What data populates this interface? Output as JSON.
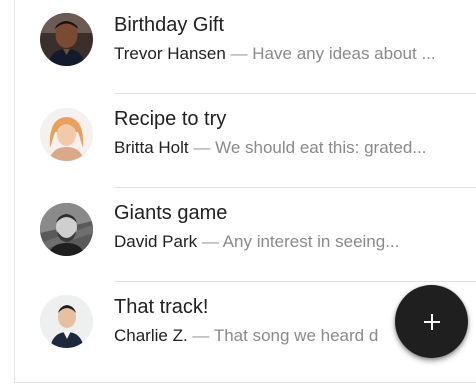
{
  "conversations": [
    {
      "title": "Birthday Gift",
      "sender": "Trevor Hansen",
      "separator": "—",
      "snippet": "Have any ideas about ...",
      "avatar_icon": "person-avatar"
    },
    {
      "title": "Recipe to try",
      "sender": "Britta Holt",
      "separator": "—",
      "snippet": "We should eat this: grated...",
      "avatar_icon": "person-avatar"
    },
    {
      "title": "Giants game",
      "sender": "David Park",
      "separator": "—",
      "snippet": "Any interest in seeing...",
      "avatar_icon": "person-avatar"
    },
    {
      "title": "That track!",
      "sender": "Charlie Z.",
      "separator": "—",
      "snippet": "That song we heard d",
      "avatar_icon": "person-avatar"
    }
  ],
  "fab": {
    "icon": "plus-icon",
    "color": "#1f1f1f"
  }
}
